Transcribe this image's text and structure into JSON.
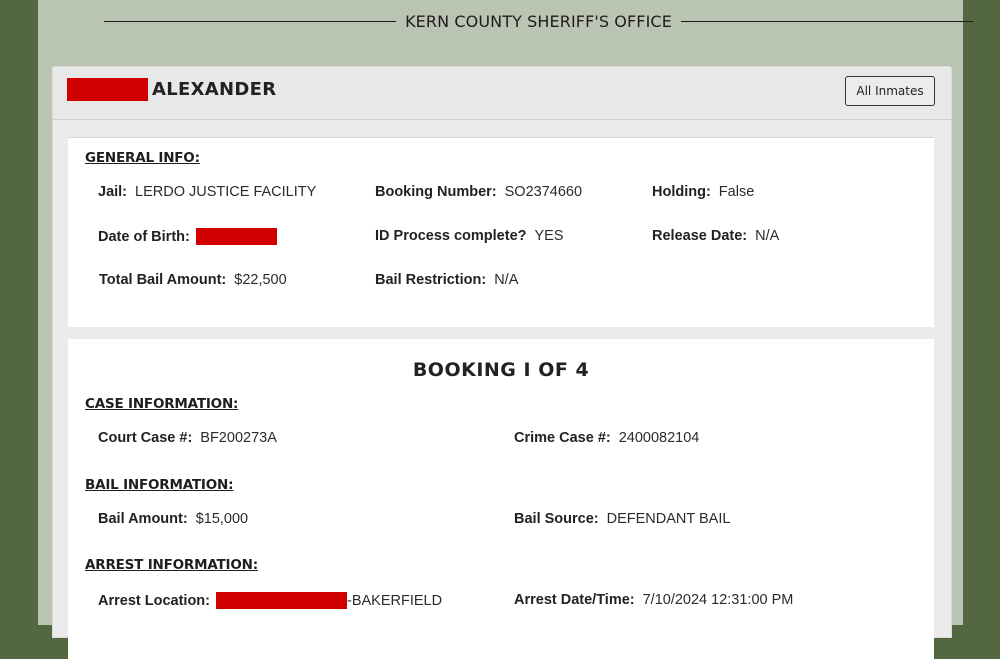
{
  "site": {
    "title": "KERN COUNTY SHERIFF'S OFFICE"
  },
  "inmate": {
    "first_name_redacted": true,
    "last_name": "ALEXANDER",
    "all_inmates_label": "All Inmates"
  },
  "general_info": {
    "heading": "GENERAL INFO:",
    "jail": {
      "label": "Jail:",
      "value": "LERDO JUSTICE FACILITY"
    },
    "booking_number": {
      "label": "Booking Number:",
      "value": "SO2374660"
    },
    "holding": {
      "label": "Holding:",
      "value": "False"
    },
    "date_of_birth": {
      "label": "Date of Birth:",
      "value_redacted": true
    },
    "id_process": {
      "label": "ID Process complete?",
      "value": "YES"
    },
    "release_date": {
      "label": "Release Date:",
      "value": "N/A"
    },
    "total_bail": {
      "label": "Total Bail Amount:",
      "value": "$22,500"
    },
    "bail_restriction": {
      "label": "Bail Restriction:",
      "value": "N/A"
    }
  },
  "booking": {
    "title": "BOOKING I OF 4",
    "case_info": {
      "heading": "CASE INFORMATION:",
      "court_case": {
        "label": "Court Case #:",
        "value": "BF200273A"
      },
      "crime_case": {
        "label": "Crime Case #:",
        "value": "2400082104"
      }
    },
    "bail_info": {
      "heading": "BAIL INFORMATION:",
      "bail_amount": {
        "label": "Bail Amount:",
        "value": "$15,000"
      },
      "bail_source": {
        "label": "Bail Source:",
        "value": "DEFENDANT BAIL"
      }
    },
    "arrest_info": {
      "heading": "ARREST INFORMATION:",
      "arrest_location": {
        "label": "Arrest Location:",
        "value_suffix": "-BAKERFIELD"
      },
      "arrest_datetime": {
        "label": "Arrest Date/Time:",
        "value": "7/10/2024 12:31:00 PM"
      }
    }
  },
  "colors": {
    "outer_background": "#536841",
    "content_background": "#b9c4b3",
    "card_background": "#ebebeb",
    "redaction": "#d10000"
  }
}
